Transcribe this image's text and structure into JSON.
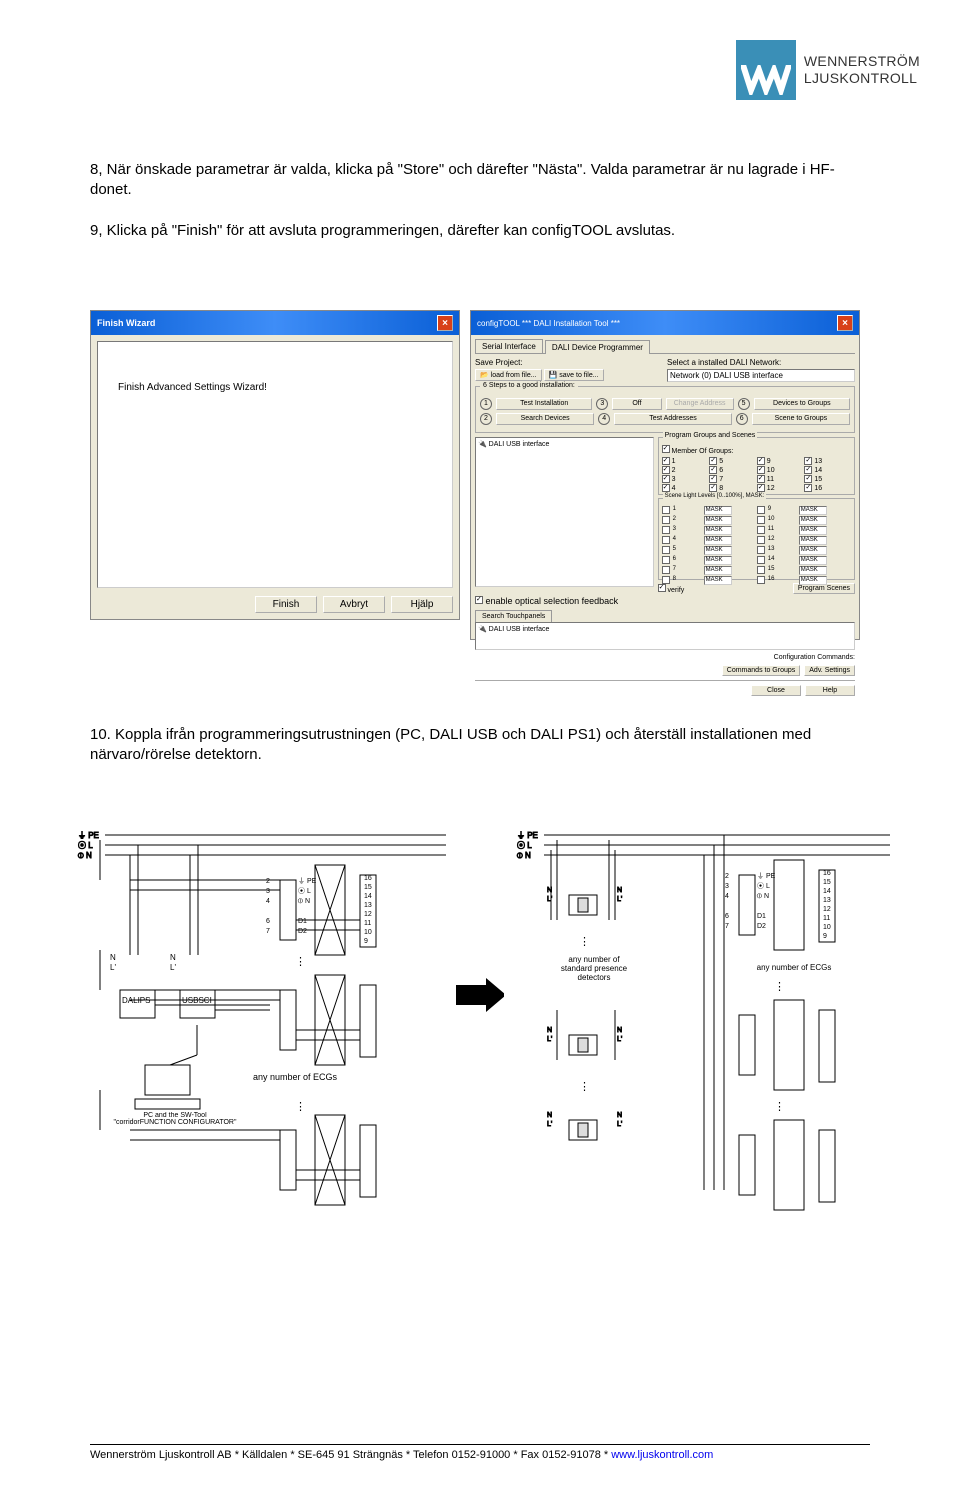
{
  "brand": {
    "line1": "WENNERSTRÖM",
    "line2": "LJUSKONTROLL"
  },
  "p1": "8, När önskade parametrar är valda, klicka på \"Store\" och därefter \"Nästa\". Valda parametrar är nu lagrade i HF-donet.",
  "p2": "9, Klicka på \"Finish\" för att avsluta programmeringen, därefter kan configTOOL avslutas.",
  "p3": "10. Koppla ifrån programmeringsutrustningen (PC, DALI USB och DALI PS1) och återställ installationen med närvaro/rörelse detektorn.",
  "win1": {
    "title": "Finish Wizard",
    "msg": "Finish Advanced Settings Wizard!",
    "btn_finish": "Finish",
    "btn_cancel": "Avbryt",
    "btn_help": "Hjälp"
  },
  "win2": {
    "title": "configTOOL    *** DALI Installation Tool ***",
    "tab1": "Serial Interface",
    "tab2": "DALI Device Programmer",
    "save_label": "Save Project:",
    "load": "load from file...",
    "save": "save to file...",
    "select_label": "Select a installed DALI Network:",
    "network": "Network (0) DALI USB interface",
    "steps_title": "6 Steps to a good installation:",
    "step1": "Test Installation",
    "step2": "Search Devices",
    "step3": "Off",
    "step3b": "Change Address",
    "step4": "Test Addresses",
    "step5": "Devices to Groups",
    "step6": "Scene to Groups",
    "list_hdr": "DALI USB interface",
    "chk_feedback": "enable optical selection feedback",
    "grp_title": "Program Groups and Scenes",
    "member_title": "Member Of Groups:",
    "g": [
      "1",
      "2",
      "3",
      "4",
      "5",
      "6",
      "7",
      "8",
      "9",
      "10",
      "11",
      "12",
      "13",
      "14",
      "15",
      "16"
    ],
    "scene_title": "Scene Light Levels [0..100%], MASK:",
    "verify": "verify",
    "prog_scenes": "Program Scenes",
    "subtab1": "Search Touchpanels",
    "subtab2": "DALI USB interface",
    "cfg_cmd": "Configuration Commands:",
    "cmd_grp": "Commands to Groups",
    "adv": "Adv. Settings",
    "close": "Close",
    "help": "Help"
  },
  "diagram_left": {
    "rails": [
      "PE",
      "L",
      "N"
    ],
    "box1": "DALI\nPS",
    "box2": "USB\nSCI",
    "pc_label": "PC and the SW-Tool\n\"corridorFUNCTION CONFIGURATOR\"",
    "n_label": "N",
    "l_label": "L",
    "term_left": [
      "2",
      "3",
      "4",
      "",
      "6",
      "7"
    ],
    "term_left_lbl": [
      "PE",
      "L",
      "N",
      "",
      "D1",
      "D2"
    ],
    "term_right": [
      "16",
      "15",
      "14",
      "13",
      "12",
      "11",
      "10",
      "9"
    ],
    "ecg_label": "any number of ECGs"
  },
  "diagram_right": {
    "det_label": "any number of\nstandard presence\ndetectors",
    "ecg_label": "any number of ECGs"
  },
  "footer": {
    "text": "Wennerström Ljuskontroll AB * Källdalen * SE-645 91 Strängnäs * Telefon 0152-91000 * Fax 0152-91078 * ",
    "link": "www.ljuskontroll.com"
  }
}
